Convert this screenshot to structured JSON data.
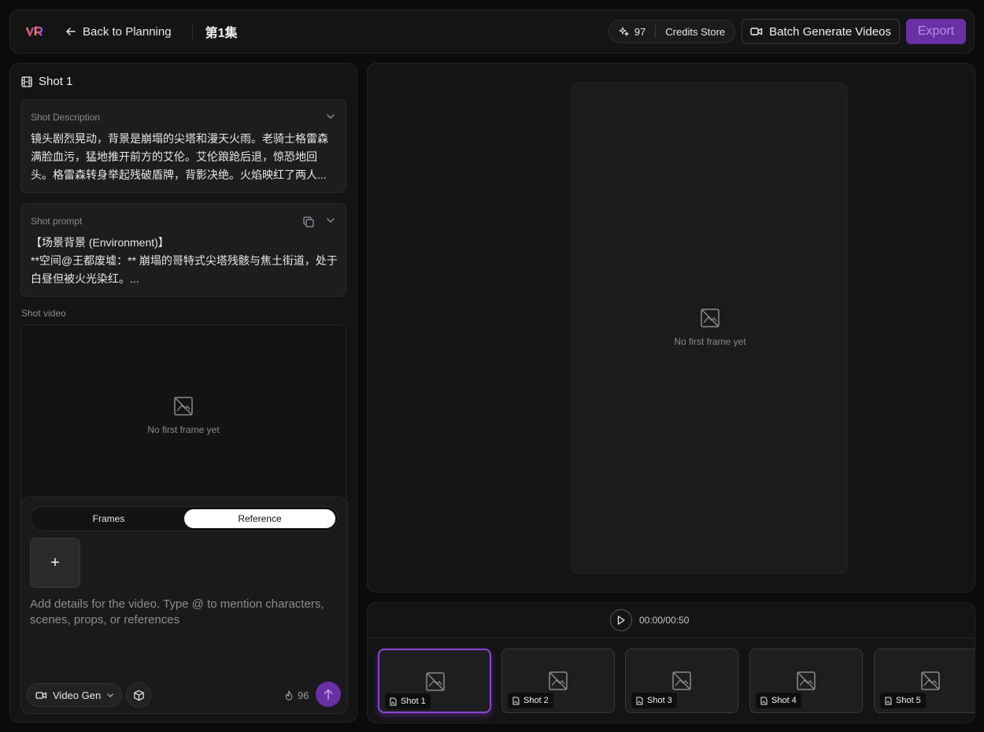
{
  "header": {
    "back_label": "Back to Planning",
    "episode_title": "第1集",
    "credits_count": "97",
    "credits_store_label": "Credits Store",
    "batch_label": "Batch Generate Videos",
    "export_label": "Export"
  },
  "shot": {
    "title": "Shot 1",
    "description_label": "Shot Description",
    "description_text": "镜头剧烈晃动，背景是崩塌的尖塔和漫天火雨。老骑士格雷森满脸血污，猛地推开前方的艾伦。艾伦踉跄后退，惊恐地回头。格雷森转身举起残破盾牌，背影决绝。火焰映红了两人...",
    "prompt_label": "Shot prompt",
    "prompt_text": "【场景背景 (Environment)】\n**空间@王都废墟：** 崩塌的哥特式尖塔残骸与焦土街道，处于白昼但被火光染红。...",
    "video_label": "Shot video",
    "empty_text": "No first frame yet"
  },
  "composer": {
    "tab_frames": "Frames",
    "tab_reference": "Reference",
    "active_tab": "Reference",
    "add_label": "+",
    "placeholder": "Add details for the video. Type @ to mention characters, scenes, props, or references",
    "mode_label": "Video Gen",
    "cost": "96"
  },
  "preview": {
    "empty_text": "No first frame yet"
  },
  "timeline": {
    "time": "00:00/00:50",
    "shots": [
      "Shot 1",
      "Shot 2",
      "Shot 3",
      "Shot 4",
      "Shot 5"
    ],
    "selected_index": 0
  },
  "colors": {
    "accent": "#6a2fa5",
    "accent_border": "#8d45d6",
    "background": "#0b0b0c",
    "panel": "#141415"
  }
}
